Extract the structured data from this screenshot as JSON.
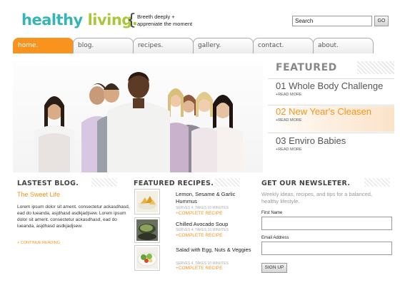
{
  "header": {
    "logo_word1": "healthy",
    "logo_word2": "living.",
    "tagline_line1": "Breeth deeply +",
    "tagline_line2": "appreniate the moment",
    "search_value": "Search",
    "go_label": "GO"
  },
  "nav": {
    "tabs": [
      {
        "label": "home."
      },
      {
        "label": "blog."
      },
      {
        "label": "recipes."
      },
      {
        "label": "gallery."
      },
      {
        "label": "contact."
      },
      {
        "label": "about."
      }
    ],
    "active_index": 0
  },
  "featured": {
    "title": "FEATURED",
    "items": [
      {
        "title": "01 Whole Body Challenge",
        "more": "+READ MORE"
      },
      {
        "title": "02 New Year's Cleasen",
        "more": "+READ MORE"
      },
      {
        "title": "03 Enviro Babies",
        "more": "+READ MORE"
      }
    ],
    "highlighted_index": 1
  },
  "blog": {
    "heading": "LASTEST BLOG.",
    "post_title": "The Sweet Life",
    "body": "Lorem ipsum dolor sit ament. consectetur ackasdhasd, ead do lueanda, asjdhasd asdkjadjsew. Lorem ipsum dolor sit ament. consectetur ackasdhasd, ead do lueanda, asjdhasd asdkjadjsew.",
    "more": "+ CONTINUE READING"
  },
  "recipes": {
    "heading": "FEATURED RECIPES.",
    "items": [
      {
        "name": "Lemon, Sesame & Garlic Hummus",
        "meta": "SERVES 4, TAKES 10 MINUTES",
        "link": "+COMPLETE RECIPE"
      },
      {
        "name": "Chilled Avocado Soup",
        "meta": "SERVES 4, TAKES 10 MINUTES",
        "link": "+COMPLETE RECIPE"
      },
      {
        "name": "Salad with Egg, Nuts & Veggies",
        "meta": "SERVES 4, TAKES 10 MINUTES",
        "link": "+COMPLETE RECIPE"
      }
    ]
  },
  "newsletter": {
    "heading": "GET OUR NEWSLETER.",
    "description": "Weekly ideas, recipes, and tips for a balanced, healthy lifestyle.",
    "first_name_label": "First Name",
    "email_label": "Email Address",
    "signup_label": "SIGN UP"
  },
  "colors": {
    "accent_orange": "#f7931e",
    "logo_teal": "#35b6b4",
    "logo_green": "#a8c83a"
  }
}
